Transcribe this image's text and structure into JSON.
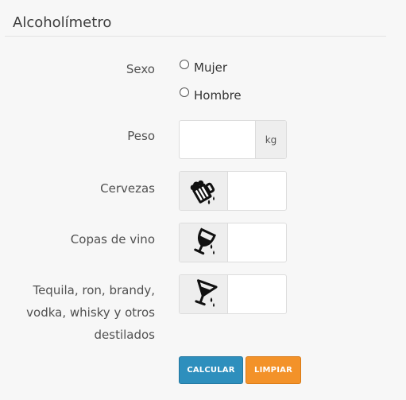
{
  "panel": {
    "title": "Alcoholímetro"
  },
  "form": {
    "sexo": {
      "label": "Sexo",
      "options": [
        "Mujer",
        "Hombre"
      ],
      "selected": null
    },
    "peso": {
      "label": "Peso",
      "value": "",
      "unit": "kg"
    },
    "cervezas": {
      "label": "Cervezas",
      "value": "",
      "icon": "beer-mug-icon"
    },
    "vino": {
      "label": "Copas de vino",
      "value": "",
      "icon": "wine-glass-icon"
    },
    "destilados": {
      "label_lines": [
        "Tequila, ron, brandy,",
        "vodka, whisky y otros",
        "destilados"
      ],
      "value": "",
      "icon": "cocktail-glass-icon"
    }
  },
  "buttons": {
    "calcular": "CALCULAR",
    "limpiar": "LIMPIAR"
  },
  "colors": {
    "calcular_bg": "#2e8fbd",
    "limpiar_bg": "#f39229",
    "addon_bg": "#eeeeee",
    "page_bg": "#f7f7f7"
  }
}
